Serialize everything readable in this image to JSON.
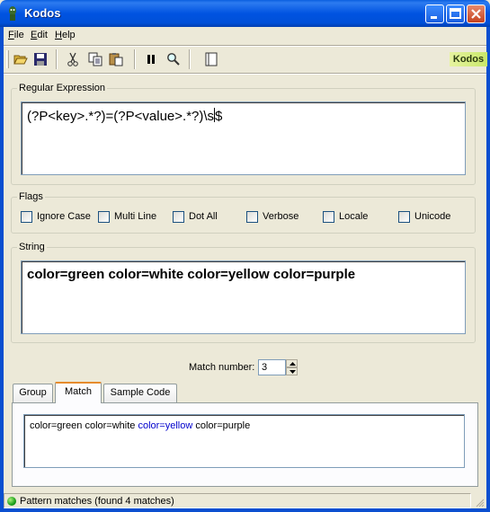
{
  "window": {
    "title": "Kodos"
  },
  "menu": {
    "file": "File",
    "file_ul": "F",
    "file_rest": "ile",
    "edit_ul": "E",
    "edit_rest": "dit",
    "help_ul": "H",
    "help_rest": "elp"
  },
  "toolbar": {
    "icons": [
      "open-folder-icon",
      "save-icon",
      "cut-icon",
      "copy-icon",
      "paste-icon",
      "pause-icon",
      "find-icon",
      "reference-book-icon"
    ],
    "logo": "Kodos"
  },
  "regex_group": {
    "legend": "Regular Expression",
    "value": "(?P<key>.*?)=(?P<value>.*?)\\s|$",
    "before_caret": "(?P<key>.*?)=(?P<value>.*?)\\s",
    "after_caret": "$"
  },
  "flags_group": {
    "legend": "Flags",
    "items": [
      {
        "label": "Ignore Case",
        "checked": false
      },
      {
        "label": "Multi Line",
        "checked": false
      },
      {
        "label": "Dot All",
        "checked": false
      },
      {
        "label": "Verbose",
        "checked": false
      },
      {
        "label": "Locale",
        "checked": false
      },
      {
        "label": "Unicode",
        "checked": false
      }
    ]
  },
  "string_group": {
    "legend": "String",
    "value": "color=green color=white color=yellow color=purple"
  },
  "match_number": {
    "label": "Match number:",
    "value": "3"
  },
  "tabs": [
    {
      "label": "Group",
      "active": false
    },
    {
      "label": "Match",
      "active": true
    },
    {
      "label": "Sample Code",
      "active": false
    }
  ],
  "match_result": {
    "before": "color=green color=white ",
    "highlighted": "color=yellow",
    "after": " color=purple"
  },
  "status": {
    "text": "Pattern matches (found 4 matches)",
    "indicator_color": "#1aa01a"
  },
  "colors": {
    "highlight": "#0000cc",
    "titlebar": "#0053e1"
  }
}
